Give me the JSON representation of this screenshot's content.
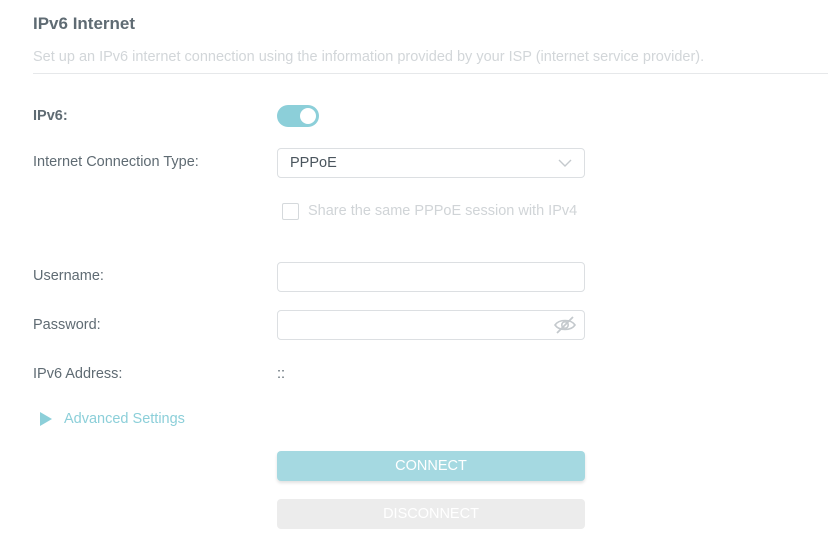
{
  "section": {
    "title": "IPv6 Internet",
    "description": "Set up an IPv6 internet connection using the information provided by your ISP (internet service provider)."
  },
  "ipv6": {
    "label": "IPv6:",
    "enabled": true
  },
  "connection_type": {
    "label": "Internet Connection Type:",
    "value": "PPPoE"
  },
  "share_session": {
    "label": "Share the same PPPoE session with IPv4",
    "checked": false
  },
  "username": {
    "label": "Username:",
    "value": ""
  },
  "password": {
    "label": "Password:",
    "value": ""
  },
  "ipv6_address": {
    "label": "IPv6 Address:",
    "value": "::"
  },
  "advanced": {
    "label": "Advanced Settings"
  },
  "buttons": {
    "connect": "CONNECT",
    "disconnect": "DISCONNECT"
  },
  "colors": {
    "accent": "#8ccfd9",
    "connect_bg": "#a5d9e1",
    "disconnect_bg": "#ececec",
    "label_text": "#5f6b73"
  },
  "icons": {
    "select_arrow": "chevron-down-icon",
    "password_toggle": "eye-slash-icon",
    "advanced_expand": "triangle-right-icon"
  }
}
